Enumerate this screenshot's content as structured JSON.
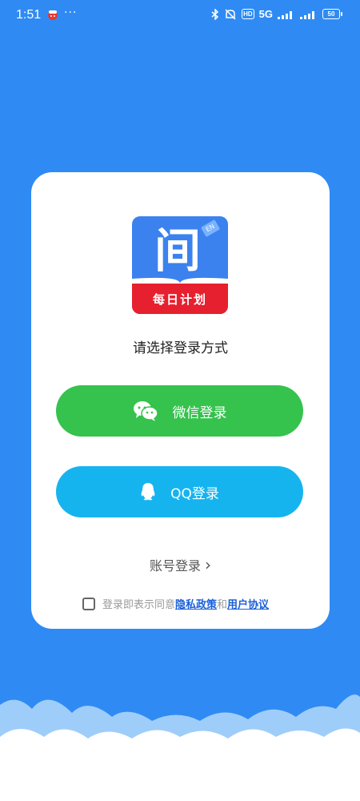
{
  "status_bar": {
    "time": "1:51",
    "dots": "···",
    "hd": "HD",
    "network": "5G",
    "battery": "50"
  },
  "logo": {
    "char": "间",
    "badge": "EN",
    "caption": "每日计划"
  },
  "login": {
    "title": "请选择登录方式",
    "wechat_label": "微信登录",
    "qq_label": "QQ登录",
    "account_label": "账号登录",
    "account_arrow": "›",
    "agree_prefix": "登录即表示同意",
    "privacy_policy": "隐私政策",
    "agree_and": "和",
    "user_agreement": "用户协议",
    "agree_checked": false
  },
  "colors": {
    "background": "#2f8bf3",
    "wechat_green": "#35c24d",
    "qq_blue": "#16b4ef",
    "logo_blue": "#3b82ef",
    "logo_red": "#e6202e",
    "link_blue": "#1a5fd8"
  }
}
